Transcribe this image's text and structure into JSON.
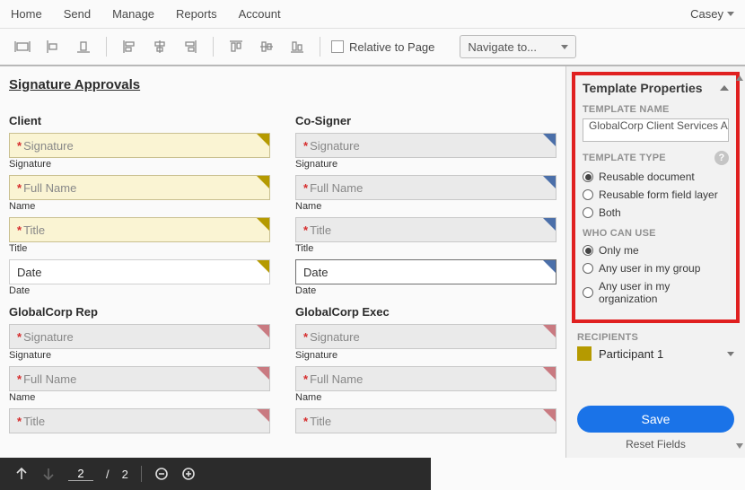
{
  "topnav": {
    "items": [
      "Home",
      "Send",
      "Manage",
      "Reports",
      "Account"
    ],
    "user": "Casey"
  },
  "toolbar": {
    "relative_label": "Relative to Page",
    "navigate_label": "Navigate to..."
  },
  "canvas": {
    "heading": "Signature Approvals",
    "groups": [
      {
        "title": "Client",
        "fields": [
          {
            "placeholder": "Signature",
            "label": "Signature",
            "required": true,
            "style": "yellow",
            "corner": "yellow"
          },
          {
            "placeholder": "Full Name",
            "label": "Name",
            "required": true,
            "style": "yellow",
            "corner": "yellow"
          },
          {
            "placeholder": "Title",
            "label": "Title",
            "required": true,
            "style": "yellow",
            "corner": "yellow"
          },
          {
            "placeholder": "Date",
            "label": "Date",
            "required": false,
            "style": "white",
            "corner": "yellow"
          }
        ]
      },
      {
        "title": "Co-Signer",
        "fields": [
          {
            "placeholder": "Signature",
            "label": "Signature",
            "required": true,
            "style": "gray",
            "corner": "blue"
          },
          {
            "placeholder": "Full Name",
            "label": "Name",
            "required": true,
            "style": "gray",
            "corner": "blue"
          },
          {
            "placeholder": "Title",
            "label": "Title",
            "required": true,
            "style": "gray",
            "corner": "blue"
          },
          {
            "placeholder": "Date",
            "label": "Date",
            "required": false,
            "style": "white dark",
            "corner": "blue"
          }
        ]
      },
      {
        "title": "GlobalCorp Rep",
        "fields": [
          {
            "placeholder": "Signature",
            "label": "Signature",
            "required": true,
            "style": "gray",
            "corner": "rose"
          },
          {
            "placeholder": "Full Name",
            "label": "Name",
            "required": true,
            "style": "gray",
            "corner": "rose"
          },
          {
            "placeholder": "Title",
            "label": "",
            "required": true,
            "style": "gray",
            "corner": "rose"
          }
        ]
      },
      {
        "title": "GlobalCorp Exec",
        "fields": [
          {
            "placeholder": "Signature",
            "label": "Signature",
            "required": true,
            "style": "gray",
            "corner": "rose"
          },
          {
            "placeholder": "Full Name",
            "label": "Name",
            "required": true,
            "style": "gray",
            "corner": "rose"
          },
          {
            "placeholder": "Title",
            "label": "",
            "required": true,
            "style": "gray",
            "corner": "rose"
          }
        ]
      }
    ]
  },
  "panel": {
    "header": "Template Properties",
    "name_label": "TEMPLATE NAME",
    "name_value": "GlobalCorp Client Services A",
    "type_label": "TEMPLATE TYPE",
    "type_options": [
      {
        "label": "Reusable document",
        "selected": true
      },
      {
        "label": "Reusable form field layer",
        "selected": false
      },
      {
        "label": "Both",
        "selected": false
      }
    ],
    "who_label": "WHO CAN USE",
    "who_options": [
      {
        "label": "Only me",
        "selected": true
      },
      {
        "label": "Any user in my group",
        "selected": false
      },
      {
        "label": "Any user in my organization",
        "selected": false
      }
    ],
    "recipients_label": "RECIPIENTS",
    "participant": "Participant 1",
    "save_label": "Save",
    "reset_label": "Reset Fields"
  },
  "footer": {
    "page_current": "2",
    "page_total": "2",
    "page_sep": "/"
  }
}
